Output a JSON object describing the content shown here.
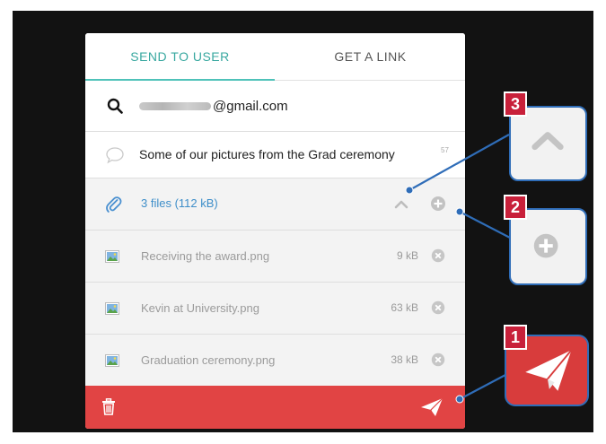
{
  "tabs": [
    {
      "label": "SEND TO USER",
      "active": true
    },
    {
      "label": "GET A LINK",
      "active": false
    }
  ],
  "recipient": {
    "email_suffix": "@gmail.com",
    "blurred_prefix": true
  },
  "message": {
    "text": "Some of our pictures from the Grad ceremony",
    "char_count": "57"
  },
  "attachments": {
    "summary": "3 files (112 kB)",
    "files": [
      {
        "name": "Receiving the award.png",
        "size": "9 kB"
      },
      {
        "name": "Kevin at University.png",
        "size": "63 kB"
      },
      {
        "name": "Graduation ceremony.png",
        "size": "38 kB"
      }
    ]
  },
  "callouts": [
    {
      "number": "1",
      "icon": "send-icon"
    },
    {
      "number": "2",
      "icon": "plus-icon"
    },
    {
      "number": "3",
      "icon": "chevron-up-icon"
    }
  ],
  "colors": {
    "accent": "#4fc2b9",
    "footer": "#e14444",
    "link": "#3e8ec9",
    "callout_border": "#2f6db8",
    "badge": "#c8203a"
  }
}
